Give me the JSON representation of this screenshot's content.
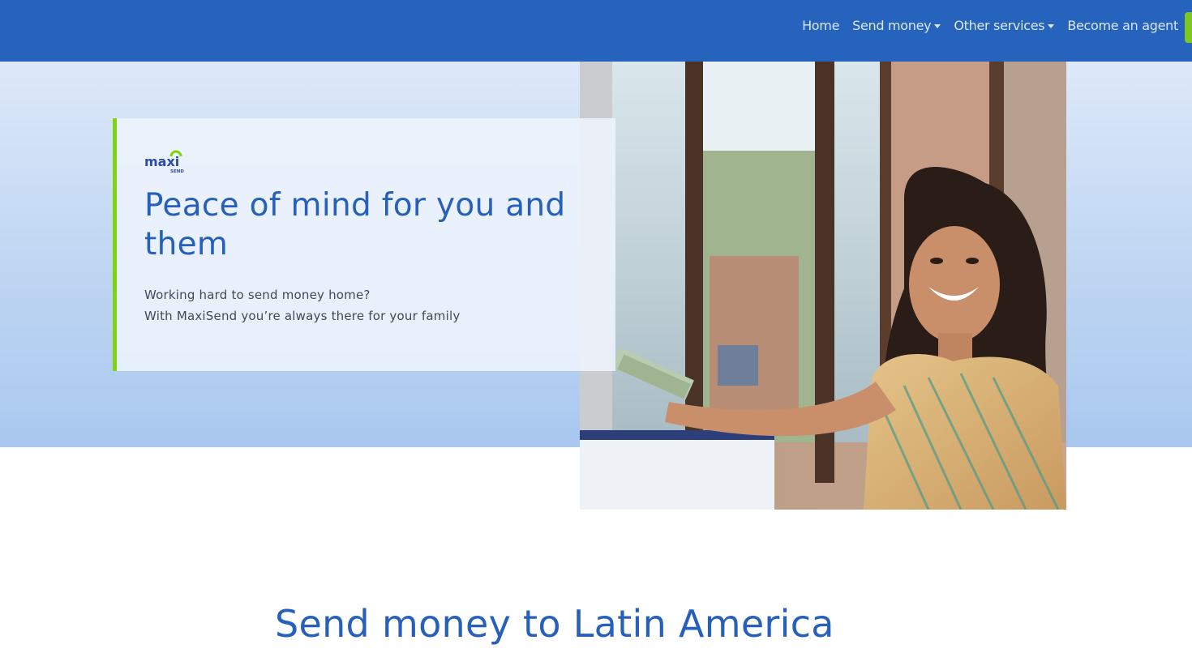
{
  "nav": {
    "items": [
      {
        "label": "Home",
        "dropdown": false
      },
      {
        "label": "Send money",
        "dropdown": true
      },
      {
        "label": "Other services",
        "dropdown": true
      },
      {
        "label": "Become an agent",
        "dropdown": false
      }
    ]
  },
  "hero": {
    "logo_text": "maxi",
    "logo_subtext": "SEND",
    "title": "Peace of mind for you and them",
    "subtitle_line1": "Working hard to send money home?",
    "subtitle_line2": "With MaxiSend you’re always there for your family"
  },
  "section": {
    "title": "Send money to Latin America"
  },
  "colors": {
    "nav_bg": "#2563bd",
    "brand_blue": "#2660bb",
    "brand_green": "#7dd40f"
  }
}
